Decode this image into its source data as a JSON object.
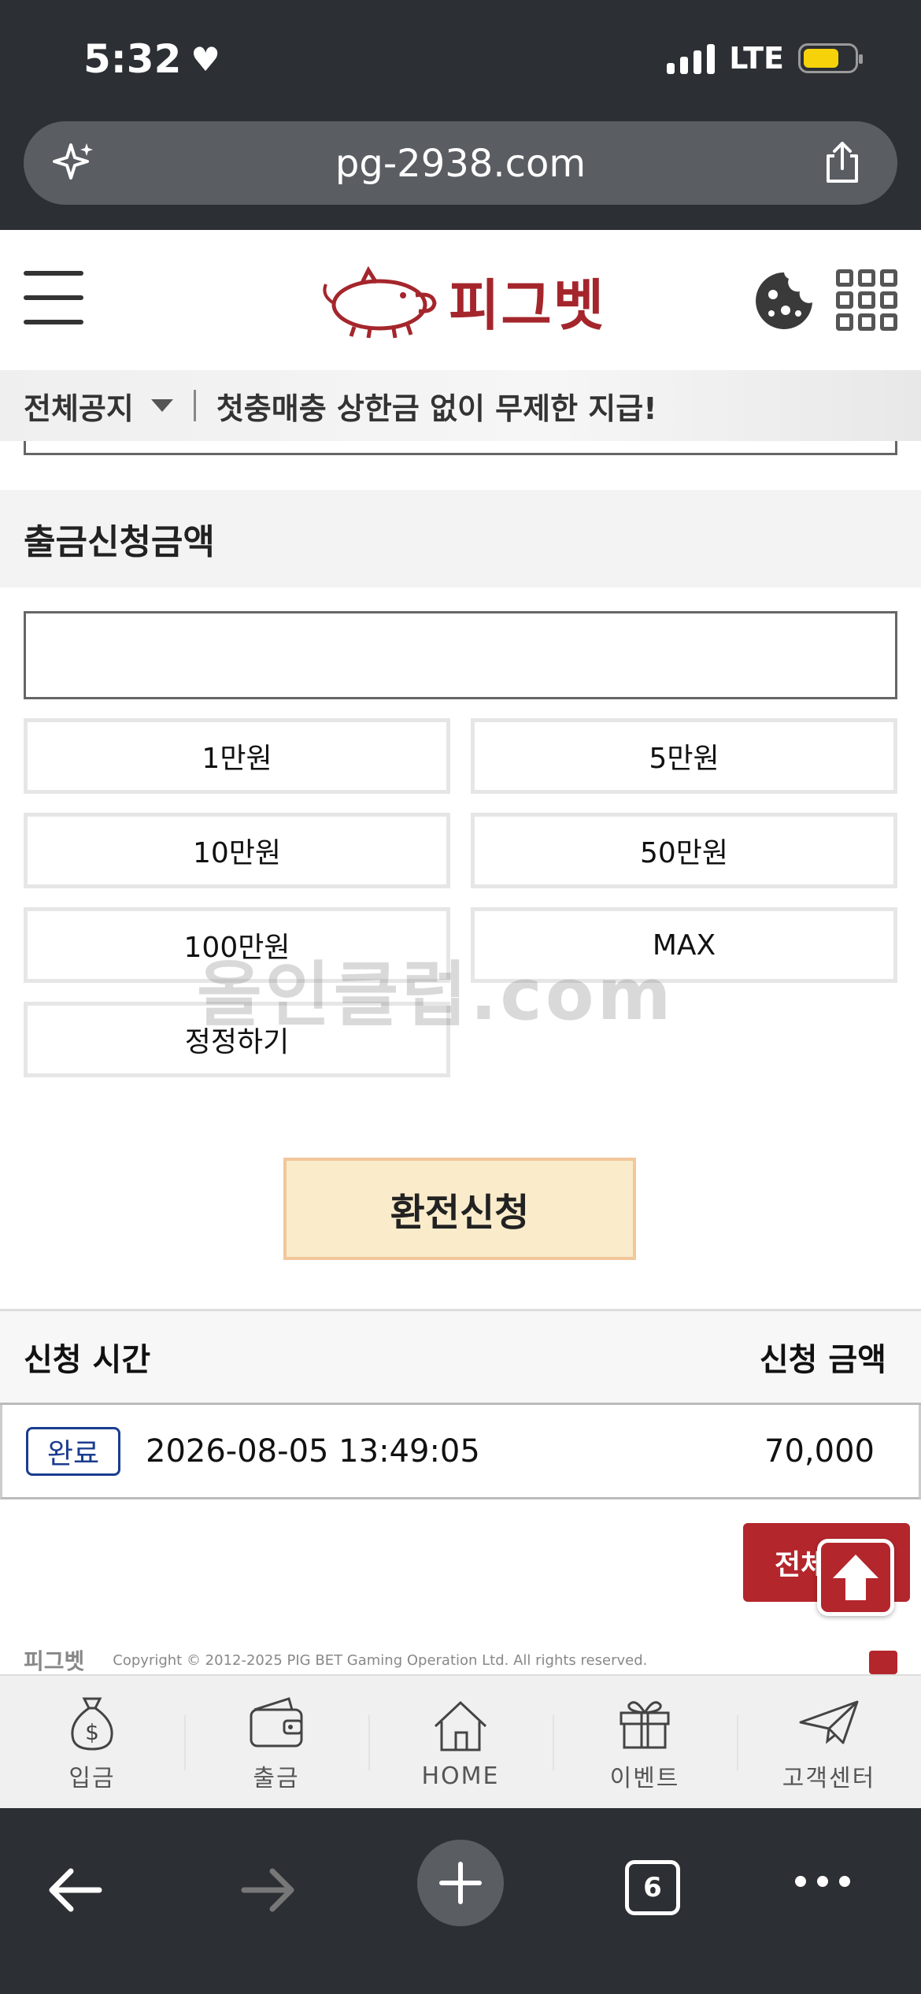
{
  "status_bar": {
    "time": "5:32",
    "network": "LTE"
  },
  "browser": {
    "url": "pg-2938.com",
    "tab_count": "6"
  },
  "site": {
    "logo_text": "피그벳"
  },
  "notice": {
    "category": "전체공지",
    "text": "첫충매충 상한금 없이 무제한 지급!"
  },
  "withdraw": {
    "section_title": "출금신청금액",
    "amount_value": "",
    "buttons": [
      "1만원",
      "5만원",
      "10만원",
      "50만원",
      "100만원",
      "MAX",
      "정정하기"
    ],
    "submit_label": "환전신청"
  },
  "history": {
    "col_time": "신청 시간",
    "col_amount": "신청 금액",
    "rows": [
      {
        "status": "완료",
        "time": "2026-08-05 13:49:05",
        "amount": "70,000"
      }
    ],
    "all_button": "전체"
  },
  "watermark": "올인클럽.com",
  "footer": {
    "logo": "피그벳",
    "copyright": "Copyright © 2012-2025 PIG BET Gaming Operation Ltd. All rights reserved."
  },
  "bottom_nav": {
    "items": [
      {
        "label": "입금",
        "icon": "money-bag-icon"
      },
      {
        "label": "출금",
        "icon": "wallet-icon"
      },
      {
        "label": "HOME",
        "icon": "home-icon"
      },
      {
        "label": "이벤트",
        "icon": "gift-icon"
      },
      {
        "label": "고객센터",
        "icon": "paper-plane-icon"
      }
    ]
  },
  "colors": {
    "brand_red": "#b3262c",
    "submit_bg": "#faeccb",
    "badge_blue": "#1b3c8f"
  }
}
